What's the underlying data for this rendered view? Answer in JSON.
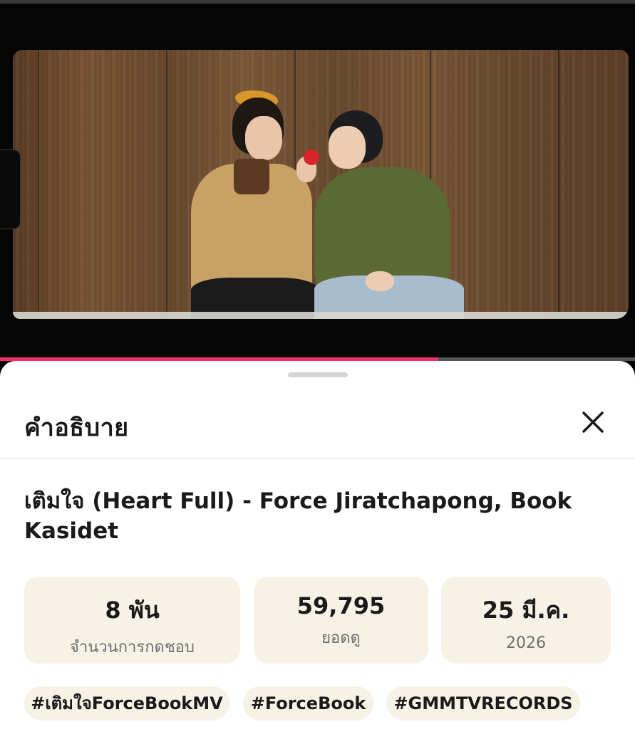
{
  "sheet": {
    "title": "คำอธิบาย",
    "video_title": "เติมใจ (Heart Full) - Force Jiratchapong, Book Kasidet",
    "stats": [
      {
        "value": "8 พัน",
        "label": "จำนวนการกดชอบ"
      },
      {
        "value": "59,795",
        "label": "ยอดดู"
      },
      {
        "value": "25 มี.ค.",
        "label": "2026"
      }
    ],
    "hashtags": [
      "#เติมใจForceBookMV",
      "#ForceBook",
      "#GMMTVRECORDS"
    ]
  },
  "player": {
    "progress": 0.69
  },
  "colors": {
    "accent": "#f0306a",
    "card_bg": "#f7f2e6",
    "text": "#1a1a1a",
    "muted": "#6f6f6f"
  },
  "icons": {
    "close": "close-icon",
    "handle": "drag-handle"
  }
}
